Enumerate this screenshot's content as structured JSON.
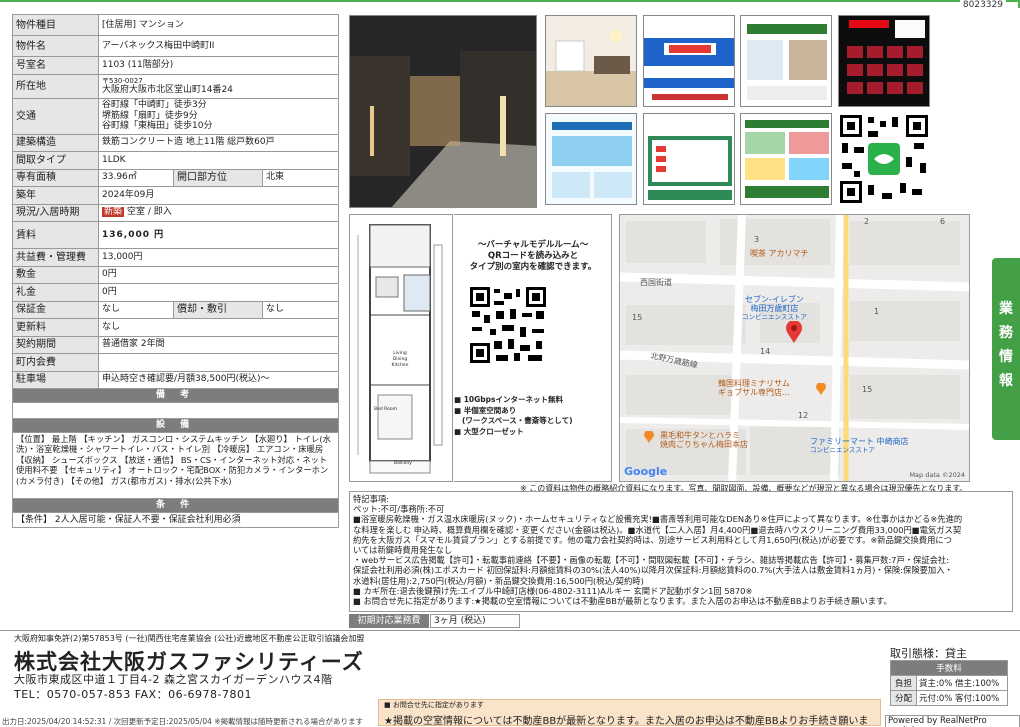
{
  "doc_id": "8023329",
  "property": {
    "type_label": "物件種目",
    "type_value": "[住居用] マンション",
    "name_label": "物件名",
    "name_value": "アーバネックス梅田中崎町II",
    "room_label": "号室名",
    "room_value": "1103 (11階部分)",
    "addr_label": "所在地",
    "addr_zip": "〒530-0027",
    "addr_value": "大阪府大阪市北区堂山町14番24",
    "traffic_label": "交通",
    "traffic": [
      "谷町線「中崎町」徒歩3分",
      "堺筋線「扇町」徒歩9分",
      "谷町線「東梅田」徒歩10分"
    ],
    "structure_label": "建築構造",
    "structure_value": "鉄筋コンクリート造 地上11階 総戸数60戸",
    "layout_label": "間取タイプ",
    "layout_value": "1LDK",
    "area_label": "専有面積",
    "area_value": "33.96㎡",
    "dir_label": "開口部方位",
    "dir_value": "北東",
    "built_label": "築年",
    "built_value": "2024年09月",
    "status_label": "現況/入居時期",
    "status_badge": "新築",
    "status_value": "空室 / 即入",
    "rent_label": "賃料",
    "rent_value": "136,000 円",
    "fee_label": "共益費・管理費",
    "fee_value": "13,000円",
    "deposit_label": "敷金",
    "deposit_value": "0円",
    "key_label": "礼金",
    "key_value": "0円",
    "guarantee_label": "保証金",
    "guarantee_value": "なし",
    "amort_label": "償却・敷引",
    "amort_value": "なし",
    "renew_label": "更新料",
    "renew_value": "なし",
    "contract_label": "契約期間",
    "contract_value": "普通借家 2年間",
    "assoc_label": "町内会費",
    "assoc_value": "",
    "parking_label": "駐車場",
    "parking_value": "申込時空き確認要/月額38,500円(税込)～",
    "remarks_head": "備 考",
    "facility_head": "設 備",
    "facility_text": "【位置】 最上階 【キッチン】 ガスコンロ・システムキッチン 【水廻り】 トイレ(水洗)・浴室乾燥機・シャワートイレ・バス・トイレ別 【冷暖房】 エアコン・床暖房 【収納】 シューズボックス 【放送・通信】 BS・CS・インターネット対応・ネット使用料不要 【セキュリティ】 オートロック・宅配BOX・防犯カメラ・インターホン(カメラ付き) 【その他】 ガス(都市ガス)・排水(公共下水)",
    "cond_head": "条 件",
    "cond_text": "【条件】 2人入居可能・保証人不要・保証会社利用必須"
  },
  "virtual": {
    "line1": "～バーチャルモデルルーム～",
    "line2": "QRコードを読み込みと",
    "line3": "タイプ別の室内を確認できます。",
    "bullets": [
      "10Gbpsインターネット無料",
      "半個室空間あり",
      "(ワークスペース・書斎等として)",
      "大型クローゼット"
    ]
  },
  "floorplan": {
    "room1": "Living",
    "room2": "Dining",
    "room3": "Kitchen",
    "room4": "Bed Room",
    "balcony": "Balcony"
  },
  "map": {
    "labels": [
      "喫茶 アカリマチ",
      "西国街道",
      "セブン-イレブン",
      "梅田万歳町店",
      "コンビニエンスストア",
      "北野万歳筋線",
      "韓国料理ミナリサム",
      "ギョプサル専門店...",
      "黒毛和牛タンとハラミ",
      "焼肉ごりちゃん梅田本店",
      "ファミリーマート 中崎商店",
      "コンビニエンスストア"
    ],
    "numbers": [
      "2",
      "6",
      "3",
      "15",
      "1",
      "14",
      "15",
      "12"
    ],
    "google": "Google",
    "mapdata": "Map data ©2024"
  },
  "note1": "※ この資料は物件の概略紹介資料になります。写真、間取図面、設備、概要などが現況と異なる場合は現況優先となります。",
  "remarks": {
    "title": "特記事項:",
    "lines": [
      "ペット:不可/事務所:不可",
      "■浴室暖房乾燥機・ガス温水床暖房(ヌック)・ホームセキュリティなど設備充実!■書斎等利用可能なDENあり※住戸によって異なります。※仕事かはかどる※先進的",
      "な料理を楽しむ 申込時、概算費用欄を確認・変更ください(金額は税込)。■水道代【二人入居】月4,400円■退去時ハウスクリーニング費用33,000円■電気ガス契",
      "約先を大阪ガス「スマモル賃貸プラン」とする前提です。他の電力会社契約時は、別途サービス利用料として月1,650円(税込)が必要です。※新品鍵交換費用につ",
      "いては新鍵時費用発生なし",
      "・webサービス広告掲載【許可】・転載事前連絡【不要】・画像の転載【不可】・間取図転載【不可】・チラシ、雑誌等掲載広告【許可】・募集戸数:7戸・保証会社:",
      "保証会社利用必須(株)エポスカード 初回保証料:月額総賃料の30%(法人40%)以降月次保証料:月額総賃料の0.7%(大手法人は敷金賃料1ヵ月)・保険:保険要加入・",
      "水道料(居住用):2,750円(税込/月額)・新品鍵交換費用:16,500円(税込/契約時)",
      "■ カギ所在:退去後鍵預け先:エイブル中崎町店様(06-4802-3111)Aルキー 玄関ドア起動ボタン1回 5870※",
      "■ お問合せ先に指定があります:★掲載の空室情報については不動産BBが最新となります。また入居のお申込は不動産BBよりお手続き願います。"
    ]
  },
  "fee_key": "初期対応業務費",
  "fee_val": "3ヶ月 (税込)",
  "license": "大阪府知事免許(2)第57853号 (一社)関西住宅産業協会 (公社)近畿地区不動産公正取引協議会加盟",
  "company": "株式会社大阪ガスファシリティーズ",
  "address": "大阪市東成区中道１丁目4-2 森之宮スカイガーデンハウス4階",
  "phone": "TEL：0570-057-853 FAX：06-6978-7801",
  "deal": {
    "label": "取引態様：貸主",
    "head": "手数料",
    "r1k": "負担",
    "r1v": "貸主:0% 借主:100%",
    "r2k": "分配",
    "r2v": "元付:0% 客付:100%"
  },
  "yellow": {
    "l1": "■ お問合せ先に指定があります",
    "l2": "★掲載の空室情報については不動産BBが最新となります。また入居のお申込は不動産BBよりお手続き願います。"
  },
  "dates": "出力日:2025/04/20 14:52:31 / 次回更新予定日:2025/05/04 ※掲載情報は随時更新される場合があります",
  "powered": "Powered by RealNetPro co.,ltd.",
  "sidetab": [
    "業",
    "務",
    "情",
    "報"
  ]
}
